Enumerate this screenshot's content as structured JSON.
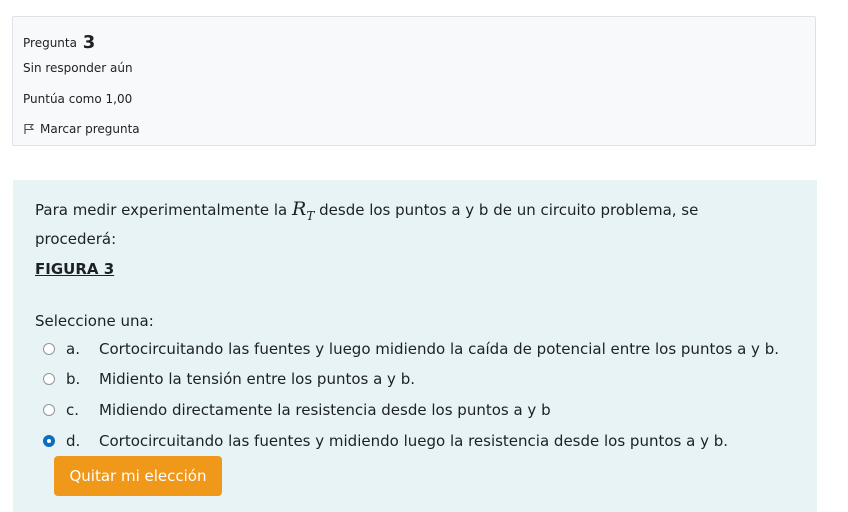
{
  "question_info": {
    "label": "Pregunta",
    "number": "3",
    "status": "Sin responder aún",
    "grade": "Puntúa como 1,00",
    "flag_label": "Marcar pregunta",
    "flag_icon": "flag-outline-icon"
  },
  "question": {
    "text_before": "Para medir experimentalmente la ",
    "rt_symbol": "R",
    "rt_subscript": "T",
    "text_after": " desde los puntos a y b de un circuito problema, se procederá:",
    "figure_label": "FIGURA 3",
    "prompt": "Seleccione una:"
  },
  "answers": [
    {
      "letter": "a.",
      "text": "Cortocircuitando las fuentes y luego midiendo la caída de potencial entre los puntos a y b.",
      "selected": false
    },
    {
      "letter": "b.",
      "text": "Midiento la tensión entre los puntos a y b.",
      "selected": false
    },
    {
      "letter": "c.",
      "text": "Midiendo directamente la resistencia desde los puntos a y b",
      "selected": false
    },
    {
      "letter": "d.",
      "text": "Cortocircuitando las fuentes y midiendo luego la resistencia desde los puntos a y b.",
      "selected": true
    }
  ],
  "clear_button": "Quitar mi elección",
  "colors": {
    "accent": "#0f6cbf",
    "button": "#f0981a",
    "content_bg": "#e7f3f5",
    "info_bg": "#f8f9fa"
  }
}
